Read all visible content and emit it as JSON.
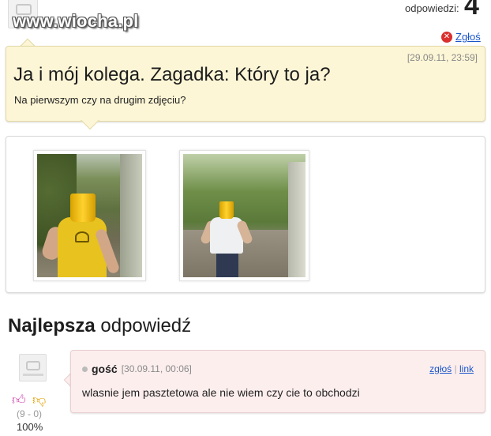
{
  "header": {
    "watermark": "www.wiocha.pl",
    "answers_label": "odpowiedzi:",
    "answers_count": "4"
  },
  "question": {
    "report_label": "Zgłoś",
    "report_icon": "close-circle-icon",
    "date": "[29.09.11, 23:59]",
    "title": "Ja i mój kolega. Zagadka: Który to ja?",
    "subtitle": "Na pierwszym czy na drugim zdjęciu?"
  },
  "images": [
    {
      "description_icon": "photo-yellow-shirt"
    },
    {
      "description_icon": "photo-white-shirt"
    }
  ],
  "best_answer": {
    "title_bold": "Najlepsza",
    "title_rest": "odpowiedź",
    "author": "gość",
    "date": "[30.09.11, 00:06]",
    "report_label": "zgłoś",
    "link_label": "link",
    "separator": "|",
    "text": "wlasnie jem pasztetowa ale nie wiem czy cie to obchodzi",
    "votes": {
      "score": "(9 - 0)",
      "percent": "100%",
      "up_icon": "thumbs-up-icon",
      "down_icon": "thumbs-down-icon",
      "up_color": "#d048b0",
      "down_color": "#e0a000"
    }
  },
  "colors": {
    "question_bg": "#fdf6d6",
    "answer_bg": "#fdeeee",
    "link": "#1a55c9",
    "report_icon": "#d9302e"
  }
}
